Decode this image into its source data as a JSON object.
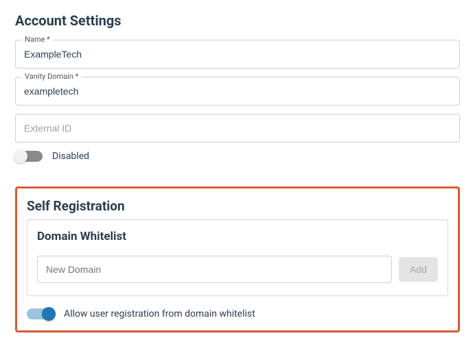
{
  "account": {
    "title": "Account Settings",
    "name_label": "Name *",
    "name_value": "ExampleTech",
    "vanity_label": "Vanity Domain *",
    "vanity_value": "exampletech",
    "external_id_placeholder": "External ID",
    "external_id_value": "",
    "disabled_toggle": {
      "on": false,
      "label": "Disabled"
    }
  },
  "self_registration": {
    "title": "Self Registration",
    "whitelist": {
      "title": "Domain Whitelist",
      "new_domain_placeholder": "New Domain",
      "new_domain_value": "",
      "add_label": "Add"
    },
    "allow_toggle": {
      "on": true,
      "label": "Allow user registration from domain whitelist"
    }
  }
}
